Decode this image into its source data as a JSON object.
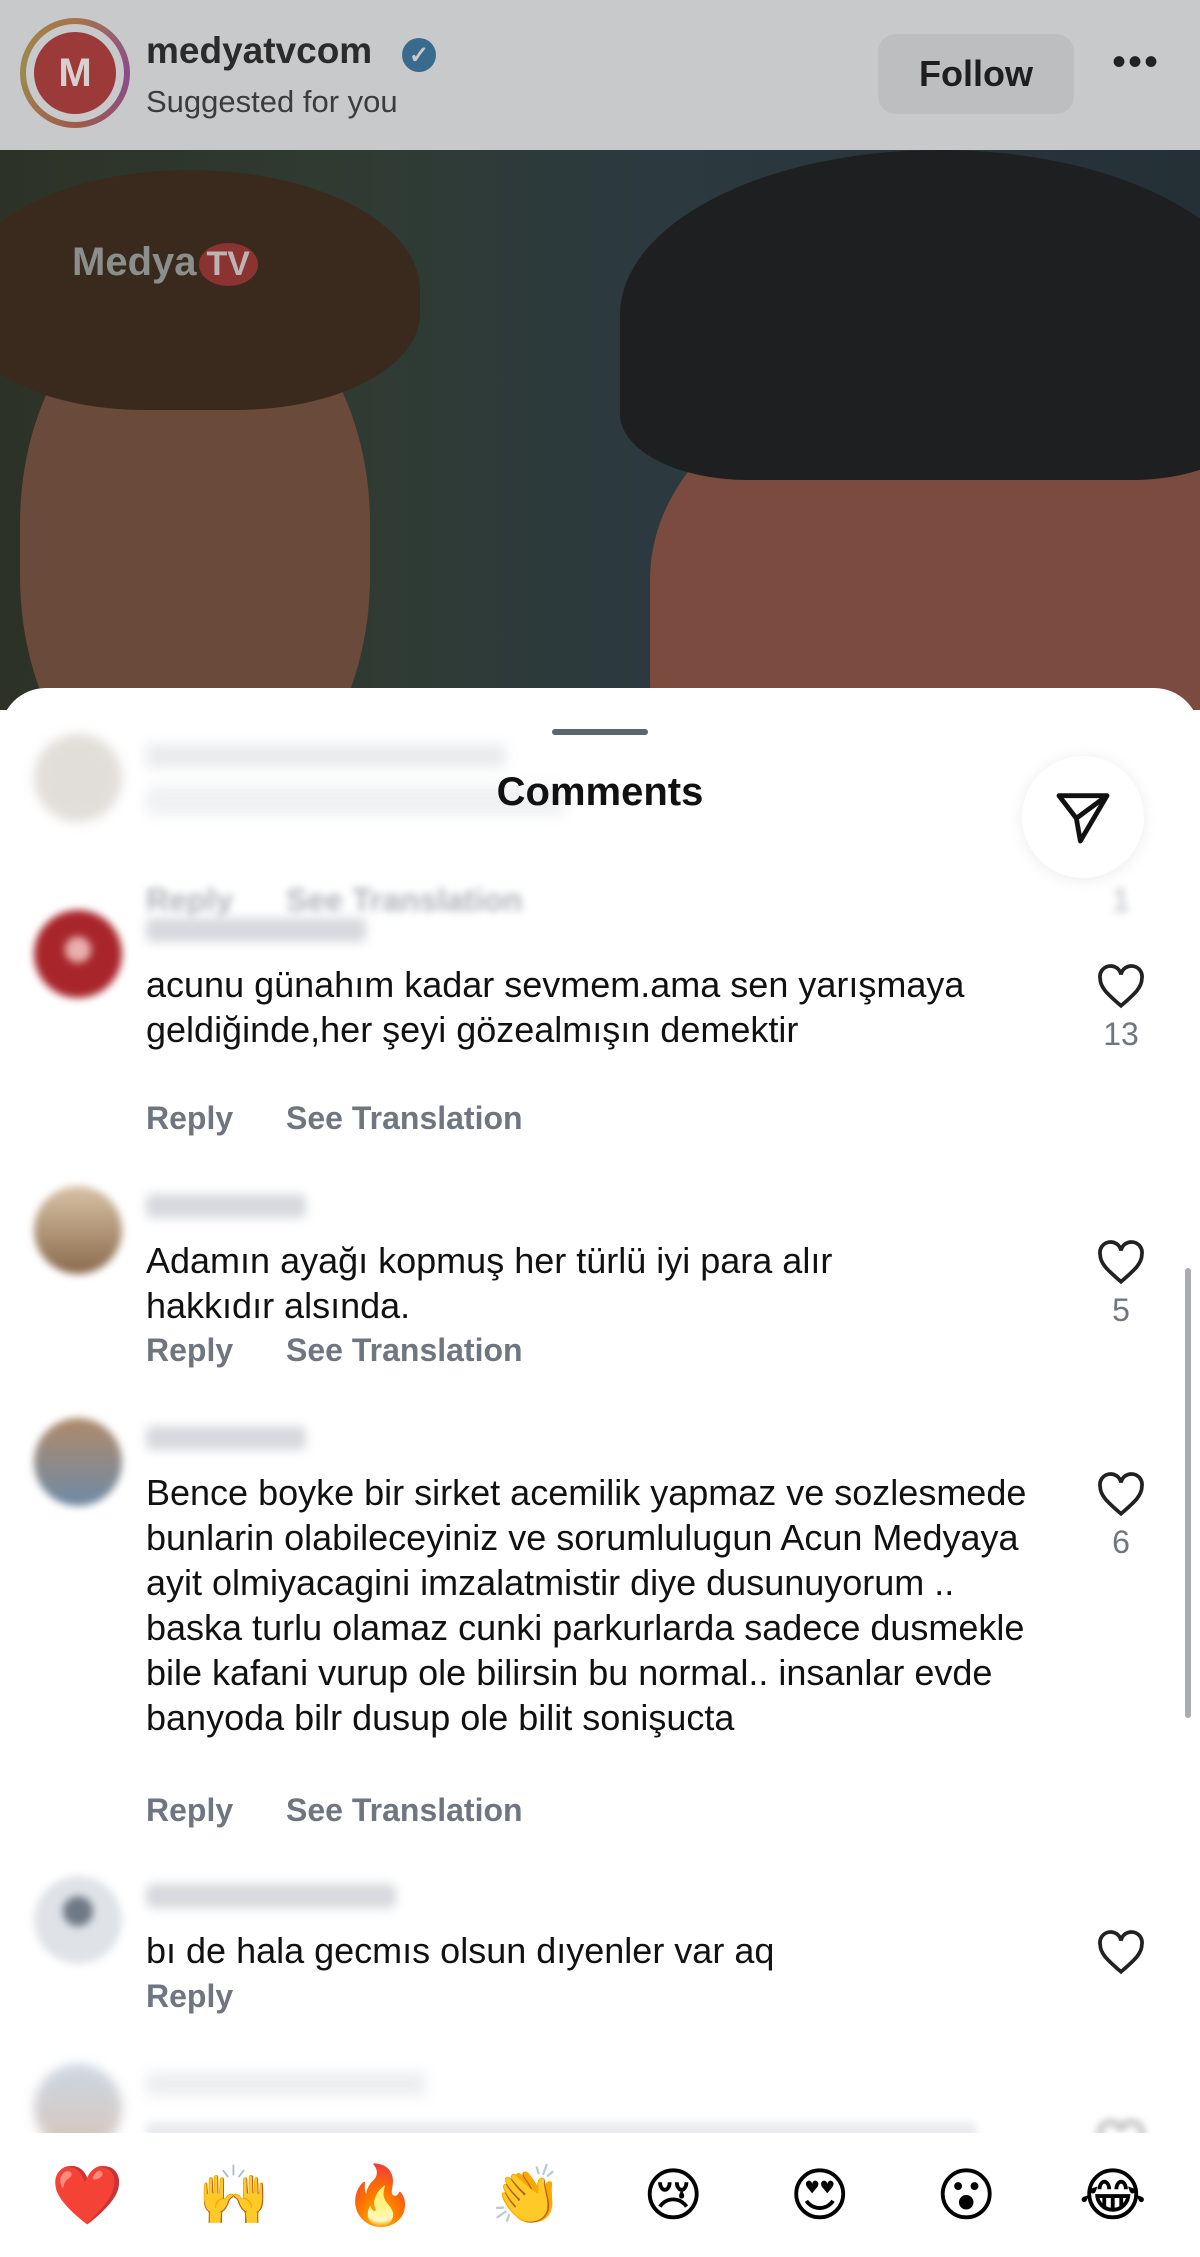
{
  "post_header": {
    "avatar_letter": "M",
    "username": "medyatvcom",
    "subtitle": "Suggested for you",
    "follow_label": "Follow",
    "more_label": "•••"
  },
  "post_image": {
    "watermark_text": "Medya",
    "watermark_badge": "TV"
  },
  "comments_sheet": {
    "title": "Comments",
    "comments": [
      {
        "username": "",
        "text": "",
        "reply_label": "Reply",
        "translate_label": "See Translation",
        "like_count": "1"
      },
      {
        "username": "",
        "text": "acunu günahım kadar sevmem.ama sen yarışmaya geldiğinde,her şeyi gözealmışın demektir",
        "reply_label": "Reply",
        "translate_label": "See Translation",
        "like_count": "13"
      },
      {
        "username": "",
        "text": "Adamın ayağı kopmuş her türlü iyi para alır hakkıdır alsında.",
        "reply_label": "Reply",
        "translate_label": "See Translation",
        "like_count": "5"
      },
      {
        "username": "",
        "text": "Bence boyke bir sirket acemilik yapmaz ve sozlesmede bunlarin olabileceyiniz ve sorumlulugun Acun Medyaya ayit olmiyacagini imzalatmistir diye dusunuyorum .. baska turlu olamaz cunki parkurlarda sadece dusmekle bile kafani vurup ole bilirsin bu normal.. insanlar evde banyoda bilr dusup ole bilit sonişucta",
        "reply_label": "Reply",
        "translate_label": "See Translation",
        "like_count": "6"
      },
      {
        "username": "",
        "text": "bı de hala gecmıs olsun dıyenler var aq",
        "reply_label": "Reply",
        "like_count": ""
      },
      {
        "username": "",
        "text": "",
        "like_count": ""
      }
    ]
  },
  "emoji_bar": [
    "❤️",
    "🙌",
    "🔥",
    "👏",
    "😢",
    "😍",
    "😮",
    "😂"
  ],
  "colors": {
    "secondary_text": "#6f7680",
    "primary_text": "#111111",
    "dim_overlay": "#c8c9cb"
  }
}
